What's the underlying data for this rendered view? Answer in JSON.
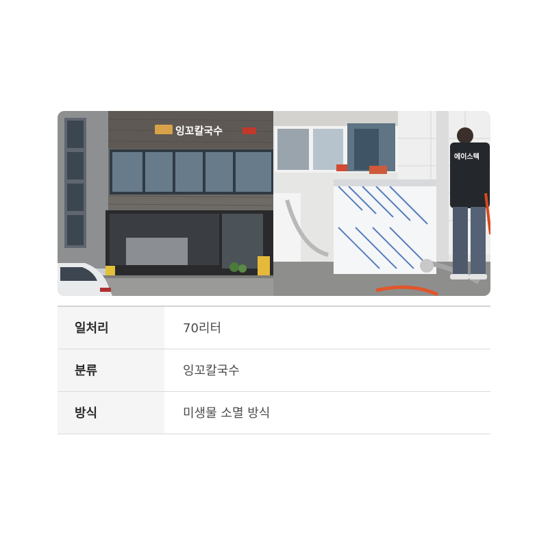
{
  "photos": {
    "left": {
      "sign_text": "잉꼬칼국수"
    },
    "right": {
      "jacket_text": "에이스텍"
    }
  },
  "specs": [
    {
      "label": "일처리",
      "value": "70리터"
    },
    {
      "label": "분류",
      "value": "잉꼬칼국수"
    },
    {
      "label": "방식",
      "value": "미생물 소멸 방식"
    }
  ]
}
